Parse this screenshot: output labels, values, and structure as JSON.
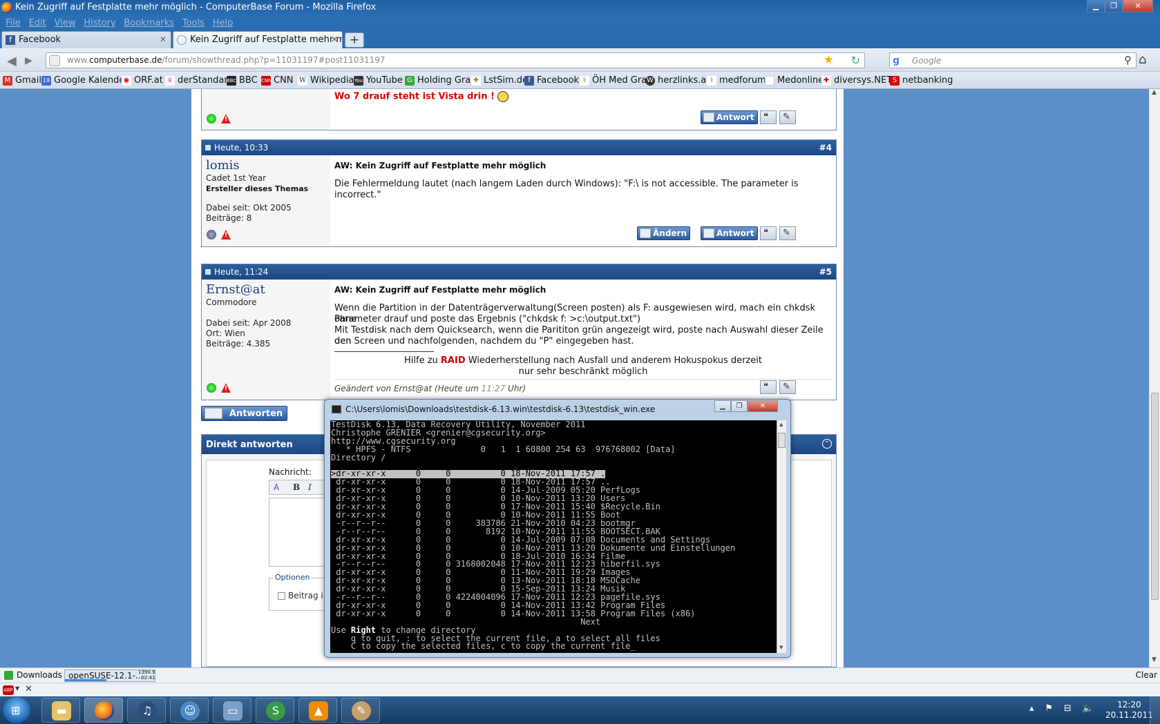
{
  "window": {
    "title": "Kein Zugriff auf Festplatte mehr möglich - ComputerBase Forum - Mozilla Firefox"
  },
  "menu": [
    "File",
    "Edit",
    "View",
    "History",
    "Bookmarks",
    "Tools",
    "Help"
  ],
  "tabs": [
    {
      "label": "Facebook",
      "active": false
    },
    {
      "label": "Kein Zugriff auf Festplatte mehr mögl...",
      "active": true
    }
  ],
  "nav": {
    "url_prefix": "www.",
    "url_domain": "computerbase.de",
    "url_path": "/forum/showthread.php?p=11031197#post11031197",
    "search_placeholder": "Google"
  },
  "bookmarks": [
    {
      "label": "Gmail",
      "icon": "gmail-icon",
      "color": "#d93025",
      "glyph": "M"
    },
    {
      "label": "Google Kalender",
      "icon": "calendar-icon",
      "color": "#3a6fd8",
      "glyph": "19"
    },
    {
      "label": "ORF.at",
      "icon": "orf-icon",
      "color": "#d00",
      "glyph": "◉"
    },
    {
      "label": "derStandard",
      "icon": "derstandard-icon",
      "color": "#e07b9a",
      "glyph": "♛"
    },
    {
      "label": "BBC",
      "icon": "bbc-icon",
      "color": "#222",
      "glyph": "▪"
    },
    {
      "label": "CNN",
      "icon": "cnn-icon",
      "color": "#c00",
      "glyph": "C"
    },
    {
      "label": "Wikipedia",
      "icon": "wikipedia-icon",
      "color": "#555",
      "glyph": "W"
    },
    {
      "label": "YouTube",
      "icon": "youtube-icon",
      "color": "#333",
      "glyph": "▶"
    },
    {
      "label": "Holding Graz",
      "icon": "holding-graz-icon",
      "color": "#3a3",
      "glyph": "G"
    },
    {
      "label": "LstSim.de",
      "icon": "lstsim-icon",
      "color": "#b7791f",
      "glyph": "✚"
    },
    {
      "label": "Facebook",
      "icon": "facebook-icon",
      "color": "#3b5998",
      "glyph": "f"
    },
    {
      "label": "ÖH Med Graz",
      "icon": "oeh-med-graz-icon",
      "color": "#5a8a2f",
      "glyph": "⚕"
    },
    {
      "label": "herzlinks.at",
      "icon": "wordpress-icon",
      "color": "#333",
      "glyph": "W"
    },
    {
      "label": "medforum",
      "icon": "medforum-icon",
      "color": "#5a8a2f",
      "glyph": "⚕"
    },
    {
      "label": "Medonline",
      "icon": "medonline-icon",
      "color": "#bbb",
      "glyph": "□"
    },
    {
      "label": "diversys.NET²",
      "icon": "diversys-icon",
      "color": "#d00",
      "glyph": "✚"
    },
    {
      "label": "netbanking",
      "icon": "netbanking-icon",
      "color": "#d00",
      "glyph": "S"
    }
  ],
  "posts": {
    "prev": {
      "signature": "Wo 7 drauf steht ist Vista drin !",
      "reply_label": "Antwort"
    },
    "p4": {
      "date": "Heute, 10:33",
      "number": "#4",
      "username": "lomis",
      "rank": "Cadet 1st Year",
      "starter": "Ersteller dieses Themas",
      "joined": "Dabei seit: Okt 2005",
      "posts_count": "Beiträge: 8",
      "title": "AW: Kein Zugriff auf Festplatte mehr möglich",
      "text": "Die Fehlermeldung lautet (nach langem Laden durch Windows): \"F:\\ is not accessible. The parameter is incorrect.\"",
      "edit_label": "Ändern",
      "reply_label": "Antwort"
    },
    "p5": {
      "date": "Heute, 11:24",
      "number": "#5",
      "username": "Ernst@at",
      "rank": "Commodore",
      "joined": "Dabei seit: Apr 2008",
      "location": "Ort: Wien",
      "posts_count": "Beiträge: 4.385",
      "title": "AW: Kein Zugriff auf Festplatte mehr möglich",
      "line1": "Wenn die Partition in der Datenträgerverwaltung(Screen posten) als F: ausgewiesen wird, mach ein chkdsk ohne",
      "line2": "Parameter drauf und poste das Ergebnis (\"chkdsk f: >c:\\output.txt\")",
      "line3": "Mit Testdisk nach dem Quicksearch, wenn die Parititon grün angezeigt wird, poste nach Auswahl dieser Zeile den",
      "line4": "den Screen und nachfolgenden, nachdem du \"P\" eingegeben hast.",
      "sig_before": "Hilfe zu ",
      "sig_raid": "RAID",
      "sig_after": " Wiederherstellung nach Ausfall und anderem Hokuspokus derzeit",
      "sig_line2": "nur sehr beschränkt möglich",
      "edited_prefix": "Geändert von Ernst@at (Heute um ",
      "edited_time": "11:27",
      "edited_suffix": " Uhr)"
    }
  },
  "answer_button": "Antworten",
  "quick_reply": {
    "title": "Direkt antworten",
    "message_label": "Nachricht:",
    "options_label": "Optionen",
    "option_checkbox": "Beitrag i"
  },
  "console": {
    "title": "C:\\Users\\lomis\\Downloads\\testdisk-6.13.win\\testdisk-6.13\\testdisk_win.exe",
    "header": [
      "TestDisk 6.13, Data Recovery Utility, November 2011",
      "Christophe GRENIER <grenier@cgsecurity.org>",
      "http://www.cgsecurity.org",
      "   * HPFS - NTFS              0   1  1 60800 254 63  976768002 [Data]",
      "Directory /",
      ""
    ],
    "selected_row": ">dr-xr-xr-x      0     0          0 18-Nov-2011 17:57 .",
    "rows": [
      " dr-xr-xr-x      0     0          0 18-Nov-2011 17:57 ..",
      " dr-xr-xr-x      0     0          0 14-Jul-2009 05:20 PerfLogs",
      " dr-xr-xr-x      0     0          0 10-Nov-2011 13:20 Users",
      " dr-xr-xr-x      0     0          0 17-Nov-2011 15:40 $Recycle.Bin",
      " dr-xr-xr-x      0     0          0 10-Nov-2011 11:55 Boot",
      " -r--r--r--      0     0     383786 21-Nov-2010 04:23 bootmgr",
      " -r--r--r--      0     0       8192 10-Nov-2011 11:55 BOOTSECT.BAK",
      " dr-xr-xr-x      0     0          0 14-Jul-2009 07:08 Documents and Settings",
      " dr-xr-xr-x      0     0          0 10-Nov-2011 13:20 Dokumente und Einstellungen",
      " dr-xr-xr-x      0     0          0 18-Jul-2010 16:34 Filme",
      " -r--r--r--      0     0 3168002048 17-Nov-2011 12:23 hiberfil.sys",
      " dr-xr-xr-x      0     0          0 11-Nov-2011 19:29 Images",
      " dr-xr-xr-x      0     0          0 13-Nov-2011 18:18 MSOCache",
      " dr-xr-xr-x      0     0          0 15-Sep-2011 13:24 Musik",
      " -r--r--r--      0     0 4224004096 17-Nov-2011 12:23 pagefile.sys",
      " dr-xr-xr-x      0     0          0 14-Nov-2011 13:42 Program Files",
      " dr-xr-xr-x      0     0          0 14-Nov-2011 13:58 Program Files (x86)"
    ],
    "next": "                                                  Next",
    "footer1_pre": "Use ",
    "footer1_key": "Right",
    "footer1_post": " to change directory",
    "footer2": "    q to quit, : to select the current file, a to select all files",
    "footer3": "    C to copy the selected files, c to copy the current file_"
  },
  "downloads": {
    "label": "Downloads",
    "item": "openSUSE-12.1-...",
    "stat1": "1390.9",
    "stat2": "02:41",
    "clear": "Clear"
  },
  "addon": {
    "abp_label": "ABP"
  },
  "clock": {
    "time": "12:20",
    "date": "20.11.2011"
  }
}
